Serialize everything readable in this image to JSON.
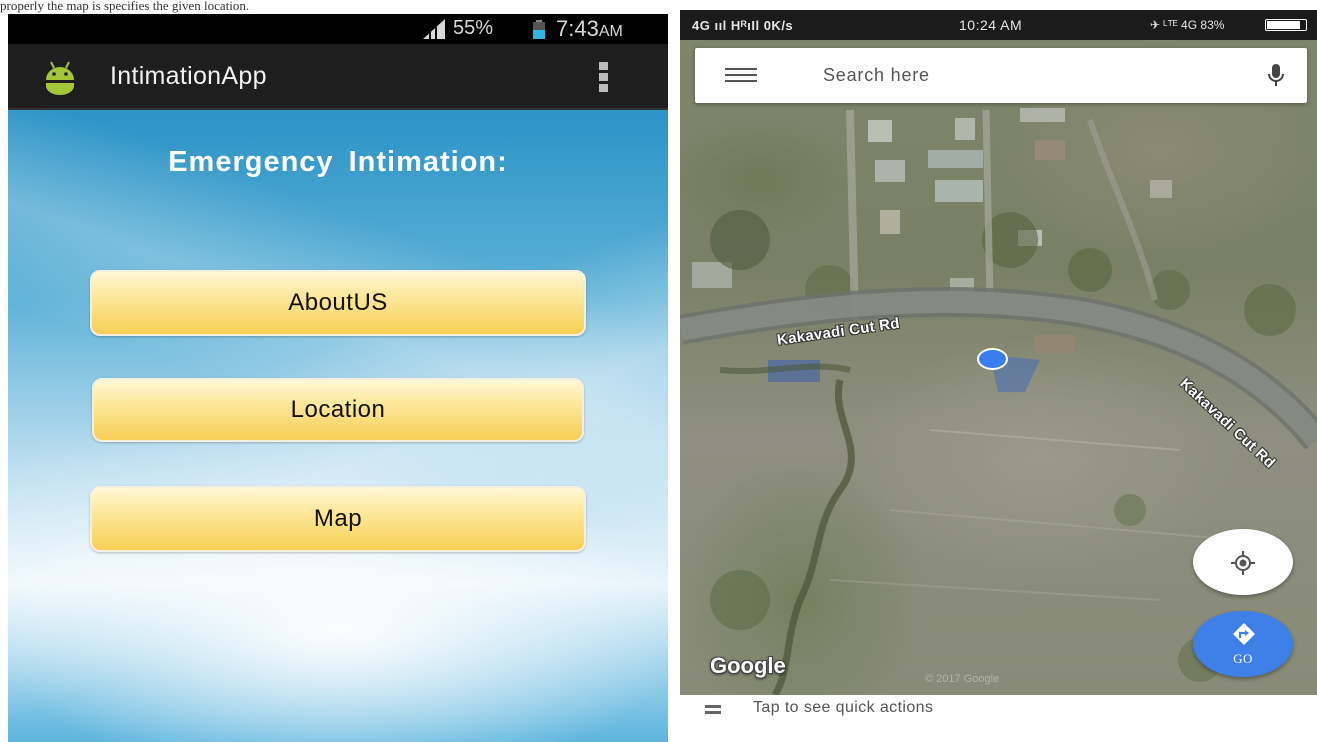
{
  "caption": "properly the map is specifies the given location.",
  "left_phone": {
    "status_bar": {
      "battery_percent": "55%",
      "time": "7:43",
      "ampm": "AM"
    },
    "app_bar": {
      "title": "IntimationApp",
      "logo_icon": "android-robot-icon",
      "menu_icon": "overflow-menu-icon"
    },
    "heading": "Emergency  Intimation:",
    "buttons": [
      "AboutUS",
      "Location",
      "Map"
    ],
    "colors": {
      "app_bar": "#1e1e1e",
      "button_gold": "#f7cf55",
      "background_blue": "#2b93c6"
    }
  },
  "right_phone": {
    "status_bar": {
      "left": "4G ııl HᴿıIl 0K/s",
      "time": "10:24 AM",
      "right": "✈ ᴸᵀᴱ 4G 83%"
    },
    "search": {
      "placeholder": "Search here"
    },
    "roads": [
      "Kakavadi Cut Rd",
      "Kakavadi Cut Rd"
    ],
    "logo": "Google",
    "watermark": "© 2017 Google",
    "go_label": "GO",
    "quick_actions": "Tap to see quick actions",
    "colors": {
      "location_dot": "#3a7df1",
      "go_button": "#3f7fe8"
    }
  }
}
